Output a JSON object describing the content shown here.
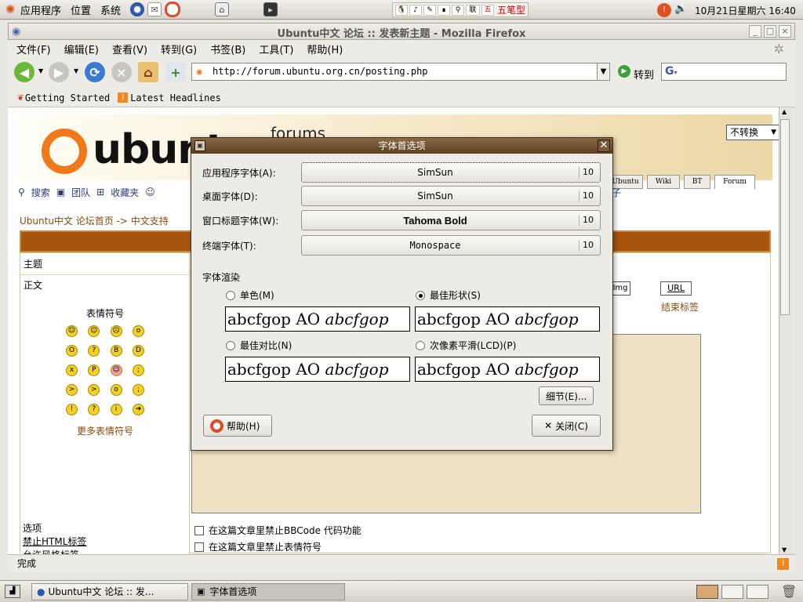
{
  "top_panel": {
    "menus": [
      "应用程序",
      "位置",
      "系统"
    ],
    "datetime": "10月21日星期六 16:40",
    "ime_label": "五笔型",
    "tray_link_label": "联"
  },
  "firefox": {
    "title": "Ubuntu中文 论坛 :: 发表新主题 - Mozilla Firefox",
    "menus": [
      "文件(F)",
      "编辑(E)",
      "查看(V)",
      "转到(G)",
      "书签(B)",
      "工具(T)",
      "帮助(H)"
    ],
    "url": "http://forum.ubuntu.org.cn/posting.php",
    "go_label": "转到",
    "bookmarks": [
      "Getting Started",
      "Latest Headlines"
    ],
    "status": "完成"
  },
  "page": {
    "logo_text": "ubuntu",
    "forums_text": "forums",
    "lang_select": "不转换",
    "tabs": [
      "Ubuntu",
      "Wiki",
      "BT",
      "Forum"
    ],
    "links": [
      "搜索",
      "团队",
      "收藏夹",
      "我的帖子"
    ],
    "breadcrumb": "Ubuntu中文 论坛首页 -> 中文支持",
    "subject_label": "主题",
    "body_label": "正文",
    "emoji_title": "表情符号",
    "more_emoji": "更多表情符号",
    "url_button": "URL",
    "img_button": "Img",
    "close_tag": "结束标签",
    "options_label": "选项",
    "opt_html": "禁止HTML标签",
    "opt_style": "允许风格标签",
    "checkbox_bbcode": "在这篇文章里禁止BBCode 代码功能",
    "checkbox_smilies": "在这篇文章里禁止表情符号"
  },
  "dialog": {
    "title": "字体首选项",
    "fonts": [
      {
        "label": "应用程序字体(A):",
        "name": "SimSun",
        "size": "10"
      },
      {
        "label": "桌面字体(D):",
        "name": "SimSun",
        "size": "10"
      },
      {
        "label": "窗口标题字体(W):",
        "name": "Tahoma Bold",
        "size": "10"
      },
      {
        "label": "终端字体(T):",
        "name": "Monospace",
        "size": "10"
      }
    ],
    "render_label": "字体渲染",
    "options": [
      {
        "label": "单色(M)",
        "selected": false
      },
      {
        "label": "最佳形状(S)",
        "selected": true
      },
      {
        "label": "最佳对比(N)",
        "selected": false
      },
      {
        "label": "次像素平滑(LCD)(P)",
        "selected": false
      }
    ],
    "sample_regular": "abcfgop AO",
    "sample_italic": "abcfgop",
    "details_button": "细节(E)...",
    "help_button": "帮助(H)",
    "close_button": "关闭(C)"
  },
  "taskbar": {
    "tasks": [
      "Ubuntu中文 论坛 :: 发...",
      "字体首选项"
    ]
  },
  "colors": {
    "accent_orange": "#f07a1a",
    "forum_bar": "#a8540c",
    "dialog_title": "#6e5030"
  }
}
